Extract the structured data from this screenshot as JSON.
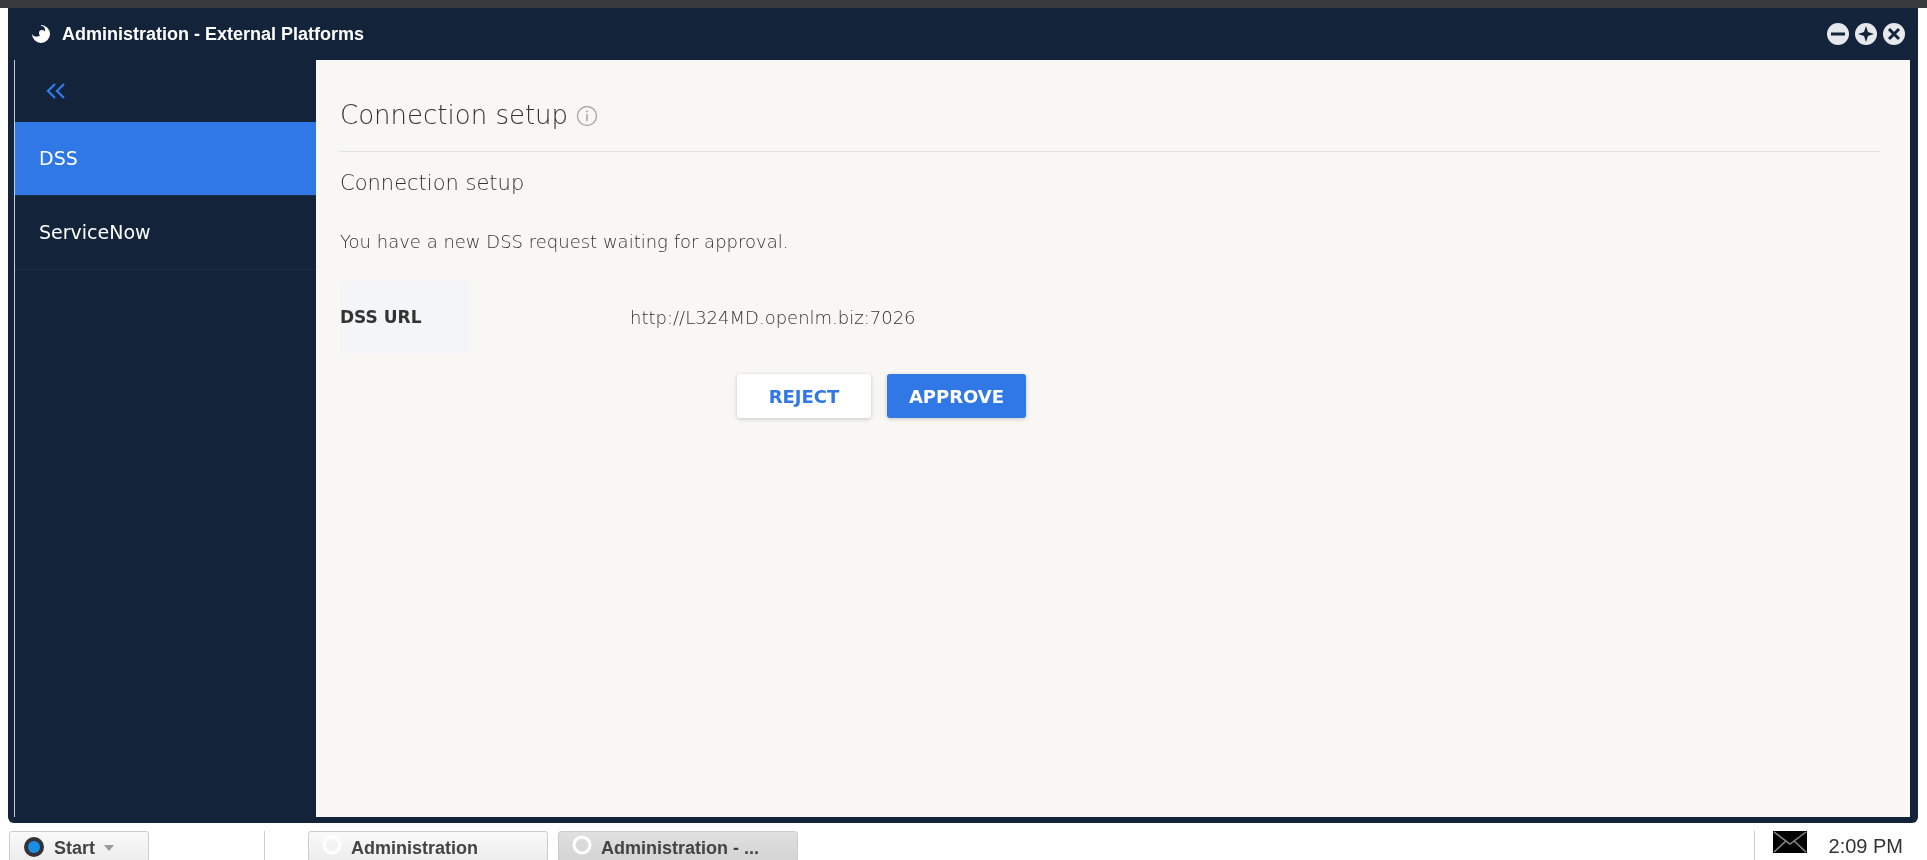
{
  "window": {
    "title": "Administration - External Platforms"
  },
  "sidebar": {
    "items": [
      {
        "label": "DSS",
        "selected": true
      },
      {
        "label": "ServiceNow",
        "selected": false
      }
    ]
  },
  "content": {
    "title": "Connection setup",
    "section_title": "Connection setup",
    "message": "You have a new DSS request waiting for approval.",
    "field": {
      "label": "DSS URL",
      "value": "http://L324MD.openlm.biz:7026"
    },
    "buttons": [
      {
        "label": "REJECT",
        "kind": "secondary"
      },
      {
        "label": "APPROVE",
        "kind": "primary"
      }
    ]
  },
  "taskbar": {
    "start": "Start",
    "items": [
      {
        "label": "Administration",
        "selected": false
      },
      {
        "label": "Administration - ...",
        "selected": true
      }
    ],
    "time": "2:09 PM"
  }
}
